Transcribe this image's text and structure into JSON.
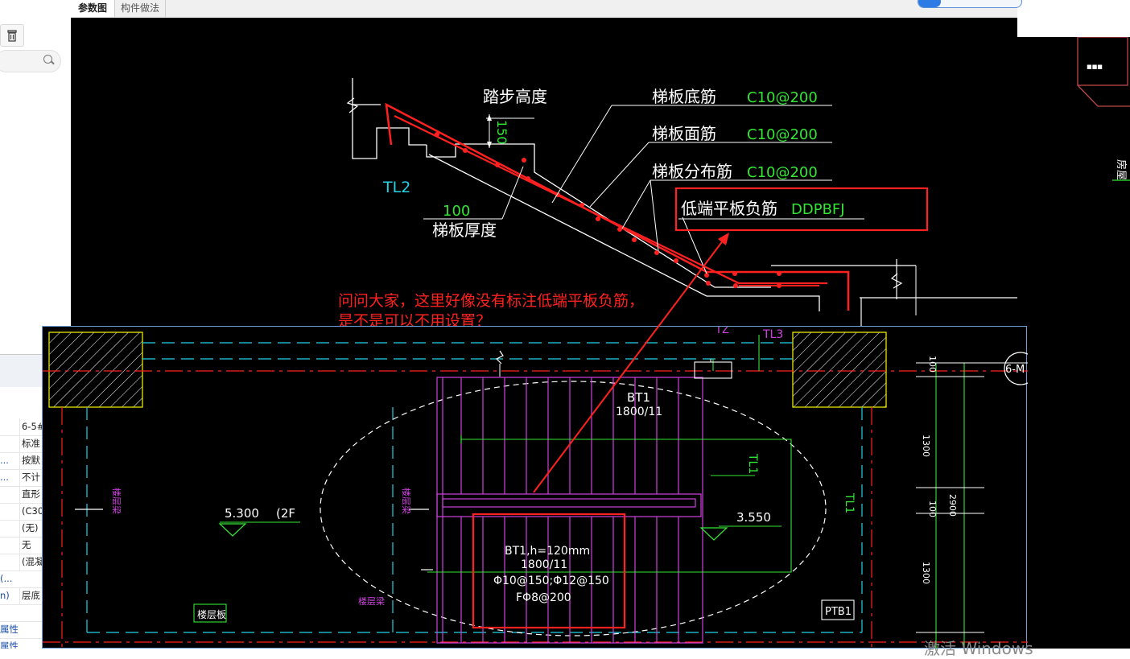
{
  "tabs": [
    {
      "label": "参数图",
      "active": true
    },
    {
      "label": "构件做法",
      "active": false
    }
  ],
  "left_panel": {
    "trash_icon": "trash-icon",
    "search_icon": "search-icon",
    "rows": [
      {
        "key": "",
        "value": "6-5#"
      },
      {
        "key": "",
        "value": "标准"
      },
      {
        "key": "...",
        "value": "按默"
      },
      {
        "key": "...",
        "value": "不计"
      },
      {
        "key": "",
        "value": "直形"
      },
      {
        "key": "",
        "value": "(C30"
      },
      {
        "key": "",
        "value": "(无)"
      },
      {
        "key": "",
        "value": "无"
      },
      {
        "key": "",
        "value": "(混凝"
      },
      {
        "key": "(...",
        "value": ""
      },
      {
        "key": "n)",
        "value": "层底"
      },
      {
        "key": "",
        "value": ""
      },
      {
        "key": "属性",
        "value": ""
      },
      {
        "key": "属性",
        "value": ""
      }
    ]
  },
  "section": {
    "step_height_label": "踏步高度",
    "step_height_value": "150",
    "tl2_label": "TL2",
    "thickness_value": "100",
    "thickness_label": "梯板厚度",
    "bottom_rebar_label": "梯板底筋",
    "bottom_rebar_value": "C10@200",
    "top_rebar_label": "梯板面筋",
    "top_rebar_value": "C10@200",
    "dist_rebar_label": "梯板分布筋",
    "dist_rebar_value": "C10@200",
    "low_neg_label": "低端平板负筋",
    "low_neg_value": "DDPBFJ"
  },
  "question": {
    "line1": "问问大家，这里好像没有标注低端平板负筋，",
    "line2": "是不是可以不用设置？"
  },
  "plan": {
    "bt1_label": "BT1",
    "bt1_sub": "1800/11",
    "bt1_detail_1": "BT1,h=120mm",
    "bt1_detail_2": "1800/11",
    "bt1_detail_3": "Φ10@150;Φ12@150",
    "bt1_detail_4": "FΦ8@200",
    "elev_left": "5.300",
    "elev_left_floor": "(2F",
    "elev_right": "3.550",
    "tl1_a": "TL1",
    "tl1_b": "TL1",
    "tz_label": "TZ",
    "tl3_label": "TL3",
    "dim_100a": "100",
    "dim_1300a": "1300",
    "dim_100b": "100",
    "dim_1300b": "1300",
    "dim_2900": "2900",
    "grid_label": "6-M",
    "floor_slab_tag": "楼层板",
    "beam_tag_1": "楼层梁",
    "beam_tag_2": "楼层梁",
    "beam_tag_3": "楼层梁",
    "ptb1_label": "PTB1"
  },
  "right_panel": {
    "mini_label": "房屋"
  },
  "watermark": "激活 Windows",
  "progress_fraction": 0.22,
  "colors": {
    "cad_bg": "#000000",
    "white_text": "#ffffff",
    "green_text": "#33e633",
    "cyan_text": "#22d3e6",
    "red": "#ff2020",
    "magenta": "#d040e0"
  }
}
